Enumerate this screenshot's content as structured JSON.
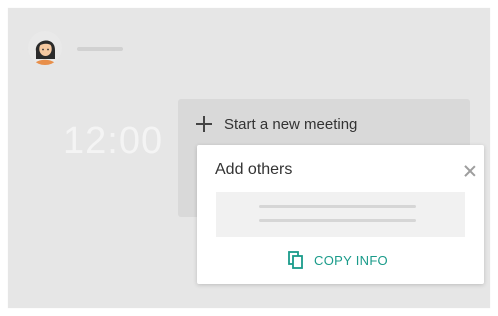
{
  "clock": {
    "time": "12:00"
  },
  "meeting_card": {
    "label": "Start a new meeting",
    "icon": "plus-icon"
  },
  "dialog": {
    "title": "Add others",
    "close_icon": "close-icon",
    "copy_label": "COPY INFO",
    "copy_icon": "copy-icon"
  },
  "colors": {
    "background": "#e6e6e6",
    "card": "#d9d9d9",
    "accent": "#1a9b8a",
    "dialog": "#ffffff"
  }
}
